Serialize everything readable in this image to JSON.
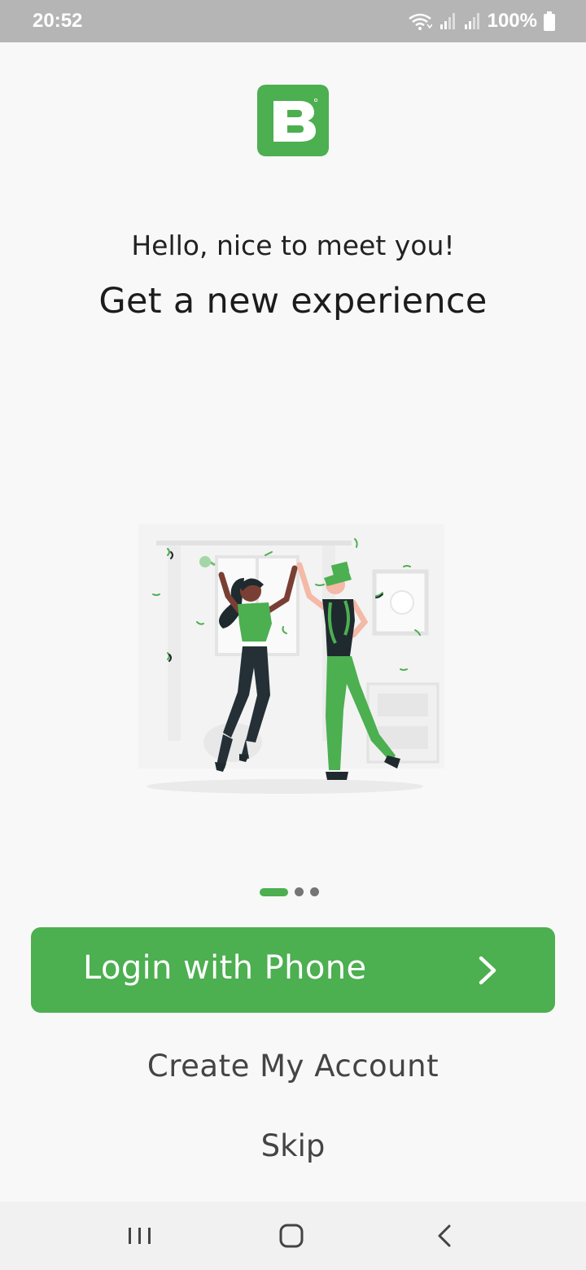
{
  "status_bar": {
    "time": "20:52",
    "battery_text": "100%",
    "icons": [
      "wifi-icon",
      "signal-icon",
      "signal-icon",
      "battery-icon"
    ]
  },
  "logo": {
    "letter": "B",
    "color": "#4caf50"
  },
  "onboarding": {
    "greeting": "Hello, nice to meet you!",
    "headline": "Get a new experience",
    "illustration": "celebrating-couple-illustration",
    "pager": {
      "total_pages": 3,
      "current_page": 1
    }
  },
  "actions": {
    "login_label": "Login with Phone",
    "login_icon": "chevron-right-icon",
    "create_account_label": "Create My Account",
    "skip_label": "Skip"
  },
  "nav_bar": {
    "buttons": [
      "recent-apps-icon",
      "home-icon",
      "back-icon"
    ]
  },
  "colors": {
    "accent": "#4caf50",
    "background": "#f8f8f8",
    "status_bar": "#b5b5b5",
    "nav_bar": "#f1f1f1"
  }
}
